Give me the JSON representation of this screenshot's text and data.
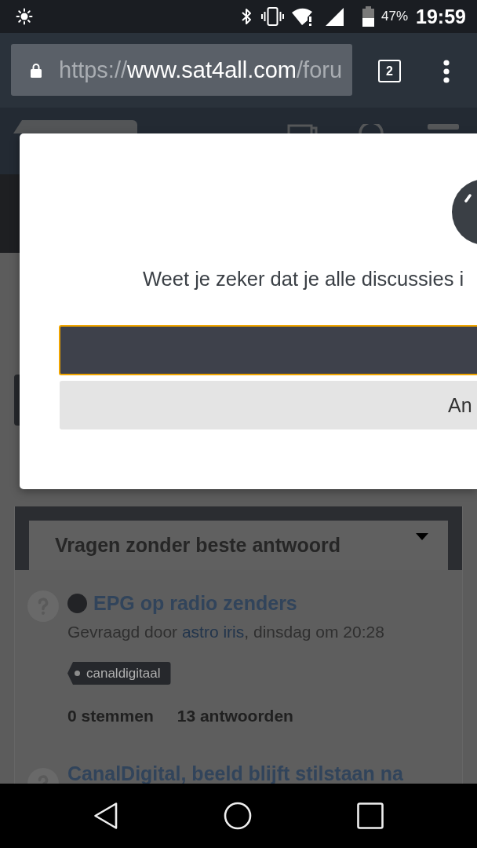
{
  "status_bar": {
    "battery": "47%",
    "time": "19:59"
  },
  "browser": {
    "url": {
      "scheme": "https://",
      "host": "www.sat4all.com",
      "path": "/foru"
    },
    "tab_count": "2"
  },
  "dialog": {
    "message": "Weet je zeker dat je alle discussies i",
    "buttons": [
      {
        "kind": "confirm",
        "focused": true
      },
      {
        "kind": "cancel",
        "label": "An",
        "focused": false
      }
    ]
  },
  "panel": {
    "title": "Vragen zonder beste antwoord",
    "questions": [
      {
        "title": "EPG op radio zenders",
        "unread": true,
        "asked_prefix": "Gevraagd door",
        "author": "astro iris",
        "asked_suffix": ", dinsdag om 20:28",
        "tags": [
          "canaldigitaal"
        ],
        "votes": "0 stemmen",
        "answers": "13 antwoorden"
      },
      {
        "title": "CanalDigital, beeld blijft stilstaan na",
        "unread": false
      }
    ]
  }
}
